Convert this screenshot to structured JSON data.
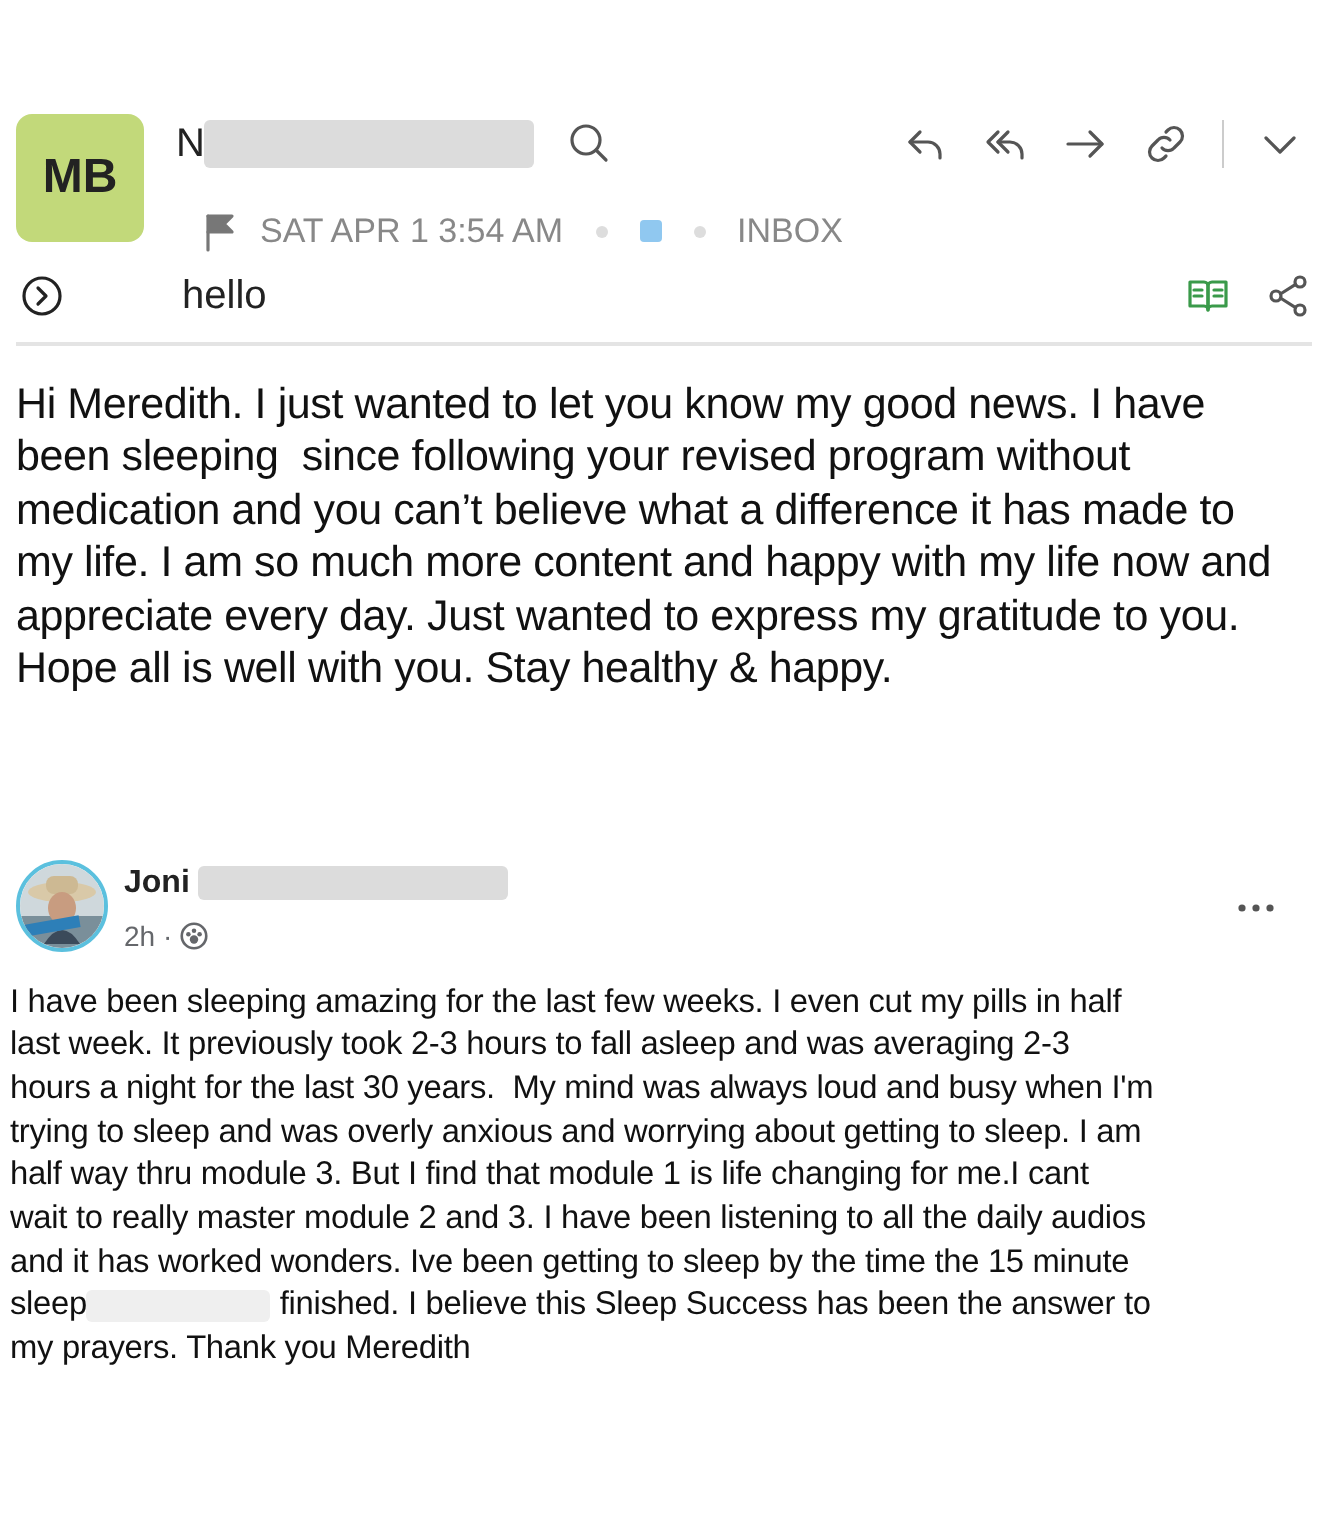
{
  "email": {
    "avatar_initials": "MB",
    "sender_partial": "N",
    "date": "SAT APR 1 3:54 AM",
    "label": {
      "color": "#90c8f0"
    },
    "folder": "INBOX",
    "subject": "hello",
    "body_lines": [
      "Hi Meredith. I just wanted to let you know my good news. I have",
      "been sleeping  since following your revised program without",
      "medication and you can’t believe what a difference it has made to",
      "my life. I am so much more content and happy with my life now and",
      "appreciate every day. Just wanted to express my gratitude to you.",
      "Hope all is well with you. Stay healthy & happy."
    ]
  },
  "post": {
    "author": "Joni",
    "time": "2h ·",
    "lines_before": [
      "I have been sleeping amazing for the last few weeks. I even cut my pills in half",
      "last week. It previously took 2-3 hours to fall asleep and was averaging 2-3",
      "hours a night for the last 30 years.  My mind was always loud and busy when I'm",
      "trying to sleep and was overly anxious and worrying about getting to sleep. I am",
      "half way thru module 3. But I find that module 1 is life changing for me.I cant",
      "wait to really master module 2 and 3. I have been listening to all the daily audios",
      "and it has worked wonders. Ive been getting to sleep by the time the 15 minute",
      "sleep"
    ],
    "lines_after": [
      " finished. I believe this Sleep Success has been the answer to",
      "my prayers. Thank you Meredith"
    ]
  }
}
